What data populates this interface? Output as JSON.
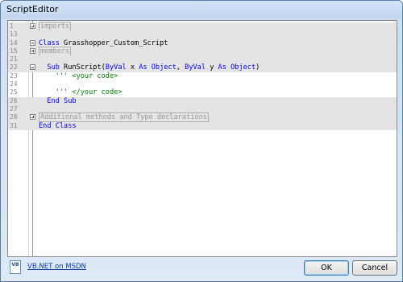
{
  "window": {
    "title": "ScriptEditor"
  },
  "editor": {
    "lines": [
      {
        "num": "1",
        "tokens": [
          {
            "t": "imports",
            "c": "region"
          }
        ],
        "fold": "plus",
        "shade": true
      },
      {
        "num": "13",
        "tokens": [],
        "shade": true
      },
      {
        "num": "14",
        "tokens": [
          {
            "t": "Class",
            "c": "kw"
          },
          {
            "t": " Grasshopper_Custom_Script",
            "c": "plain"
          }
        ],
        "fold": "minus",
        "shade": true
      },
      {
        "num": "15",
        "tokens": [
          {
            "t": "members",
            "c": "region"
          }
        ],
        "fold": "plus",
        "shade": true
      },
      {
        "num": "21",
        "tokens": [],
        "shade": true
      },
      {
        "num": "22",
        "tokens": [
          {
            "t": "  Sub ",
            "c": "kw"
          },
          {
            "t": "RunScript(",
            "c": "plain"
          },
          {
            "t": "ByVal",
            "c": "kw"
          },
          {
            "t": " x ",
            "c": "plain"
          },
          {
            "t": "As Object",
            "c": "kw"
          },
          {
            "t": ", ",
            "c": "plain"
          },
          {
            "t": "ByVal",
            "c": "kw"
          },
          {
            "t": " y ",
            "c": "plain"
          },
          {
            "t": "As Object",
            "c": "kw"
          },
          {
            "t": ")",
            "c": "plain"
          }
        ],
        "fold": "minus",
        "shade": true
      },
      {
        "num": "23",
        "tokens": [
          {
            "t": "    ''' <your code>",
            "c": "cm"
          }
        ],
        "shade": false
      },
      {
        "num": "24",
        "tokens": [],
        "shade": false
      },
      {
        "num": "25",
        "tokens": [
          {
            "t": "    ''' </your code>",
            "c": "cm"
          }
        ],
        "shade": false
      },
      {
        "num": "26",
        "tokens": [
          {
            "t": "  End Sub",
            "c": "kw"
          }
        ],
        "shade": true
      },
      {
        "num": "27",
        "tokens": [],
        "shade": true
      },
      {
        "num": "28",
        "tokens": [
          {
            "t": "Additional methods and Type declarations",
            "c": "region"
          }
        ],
        "fold": "plus",
        "shade": true
      },
      {
        "num": "31",
        "tokens": [
          {
            "t": "End Class",
            "c": "kw"
          }
        ],
        "shade": true
      }
    ]
  },
  "footer": {
    "icon_text": "VB",
    "link_label": "VB.NET on MSDN",
    "ok_label": "OK",
    "cancel_label": "Cancel"
  }
}
